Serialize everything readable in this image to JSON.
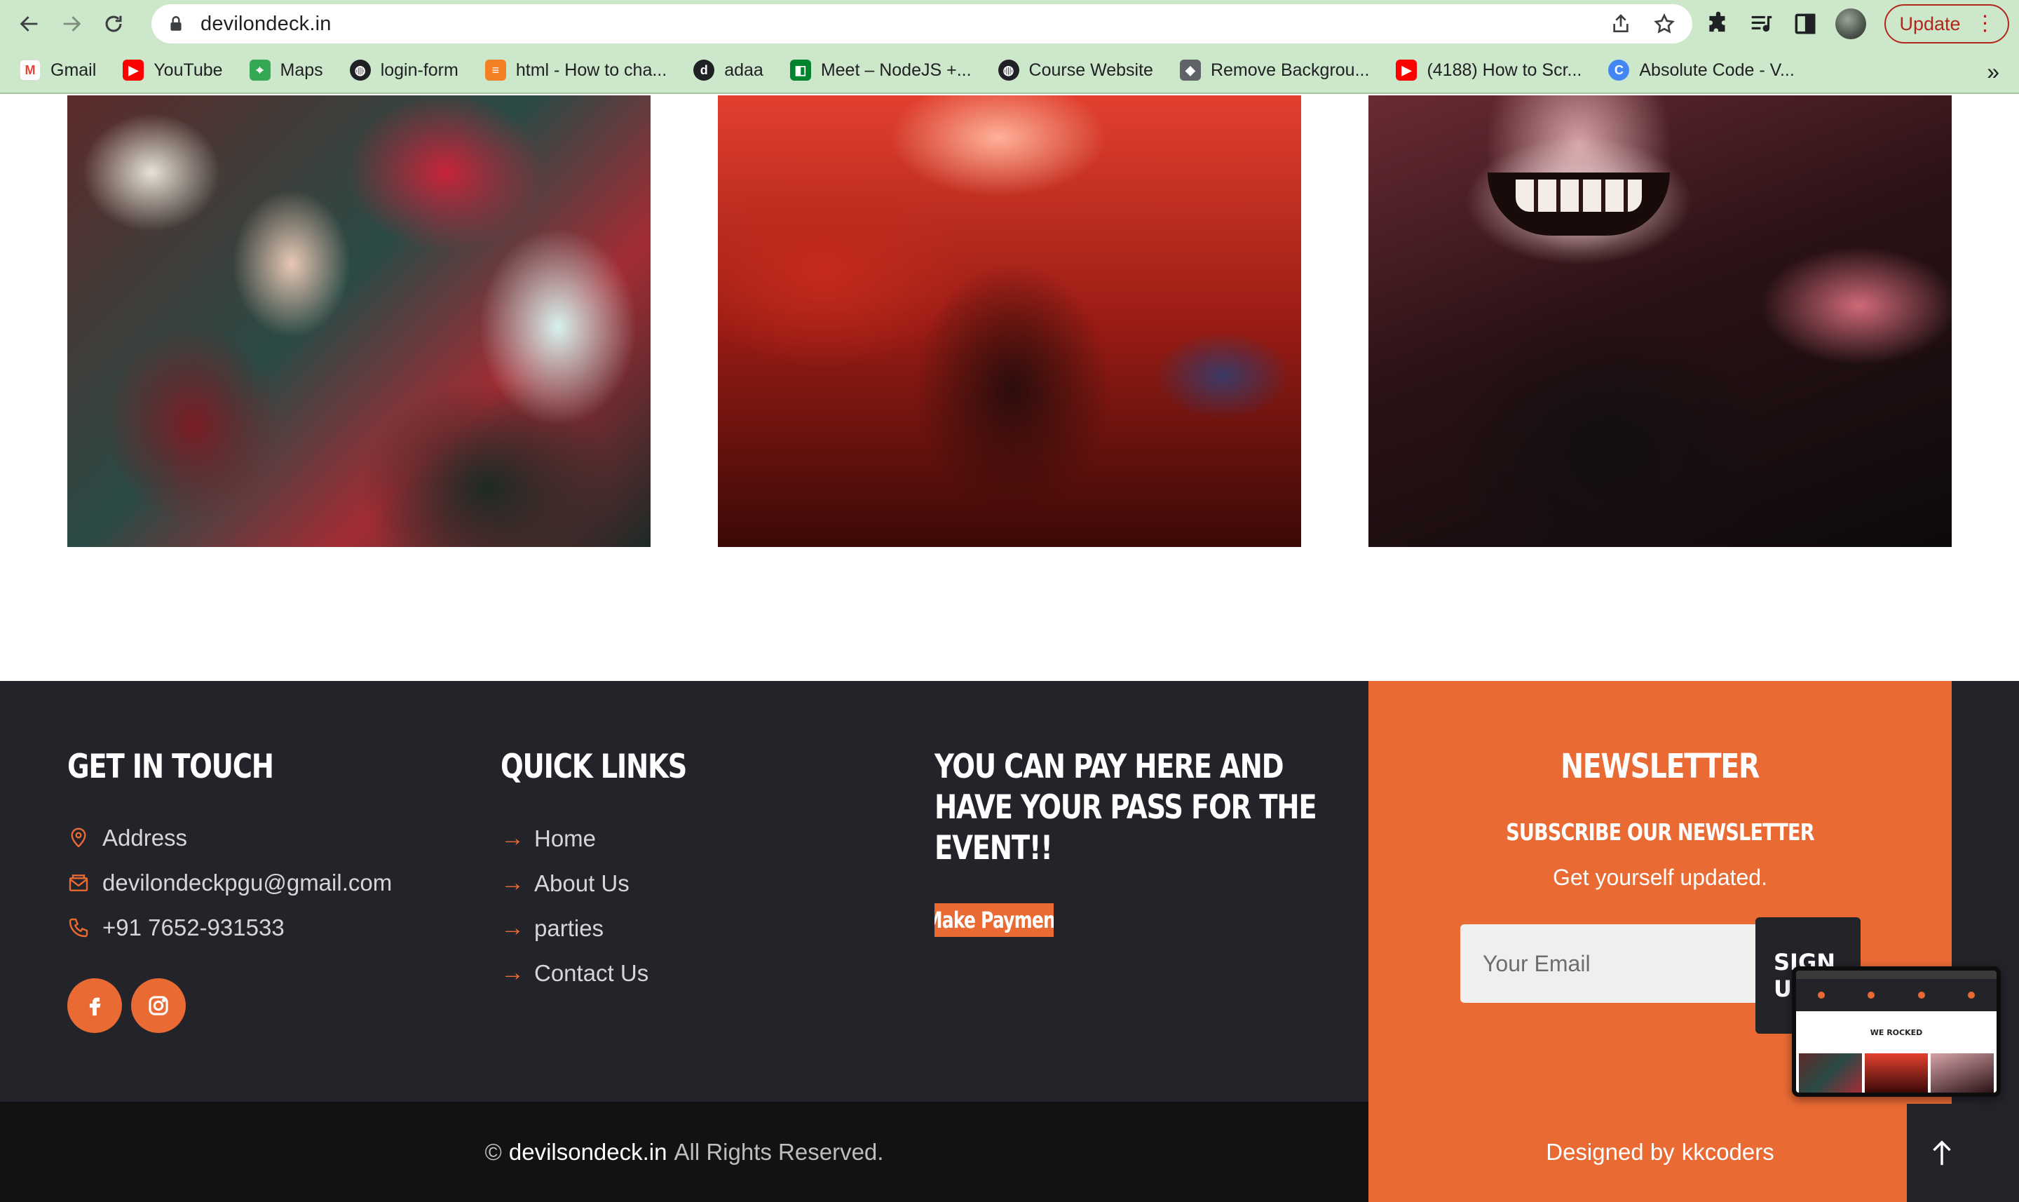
{
  "browser": {
    "url": "devilondeck.in",
    "update_label": "Update",
    "bookmarks": [
      {
        "label": "Gmail",
        "icon": "gmail-icon",
        "color": "#ea4335"
      },
      {
        "label": "YouTube",
        "icon": "youtube-icon",
        "color": "#ff0000"
      },
      {
        "label": "Maps",
        "icon": "maps-icon",
        "color": "#34a853"
      },
      {
        "label": "login-form",
        "icon": "globe-icon",
        "color": "#202124"
      },
      {
        "label": "html - How to cha...",
        "icon": "stackoverflow-icon",
        "color": "#f48024"
      },
      {
        "label": "adaa",
        "icon": "adaa-icon",
        "color": "#202124"
      },
      {
        "label": "Meet – NodeJS +...",
        "icon": "meet-icon",
        "color": "#00832d"
      },
      {
        "label": "Course Website",
        "icon": "globe-icon",
        "color": "#202124"
      },
      {
        "label": "Remove Backgrou...",
        "icon": "removebg-icon",
        "color": "#5f6368"
      },
      {
        "label": "(4188) How to Scr...",
        "icon": "youtube-icon",
        "color": "#ff0000"
      },
      {
        "label": "Absolute Code - V...",
        "icon": "absolute-code-icon",
        "color": "#4285f4"
      }
    ]
  },
  "footer": {
    "contact": {
      "title": "GET IN TOUCH",
      "address": "Address",
      "email": "devilondeckpgu@gmail.com",
      "phone": "+91 7652-931533"
    },
    "quick_links": {
      "title": "QUICK LINKS",
      "items": [
        "Home",
        "About Us",
        "parties",
        "Contact Us"
      ]
    },
    "payment": {
      "title_line1": "YOU CAN PAY HERE AND",
      "title_line2": "HAVE YOUR PASS FOR THE",
      "title_line3": "EVENT!!",
      "button": "Make Payment"
    },
    "newsletter": {
      "title": "NEWSLETTER",
      "subtitle": "SUBSCRIBE OUR NEWSLETTER",
      "description": "Get yourself updated.",
      "placeholder": "Your Email",
      "button": "SIGN UP"
    },
    "copyright": {
      "symbol": "©",
      "site": "devilsondeck.in",
      "rest": "All Rights Reserved."
    },
    "designed": {
      "prefix": "Designed by",
      "author": "kkcoders"
    }
  },
  "preview": {
    "caption": "WE ROCKED"
  },
  "colors": {
    "accent": "#ea6a34",
    "dark": "#23232a",
    "darker": "#121212",
    "chrome": "#cce7c9"
  }
}
